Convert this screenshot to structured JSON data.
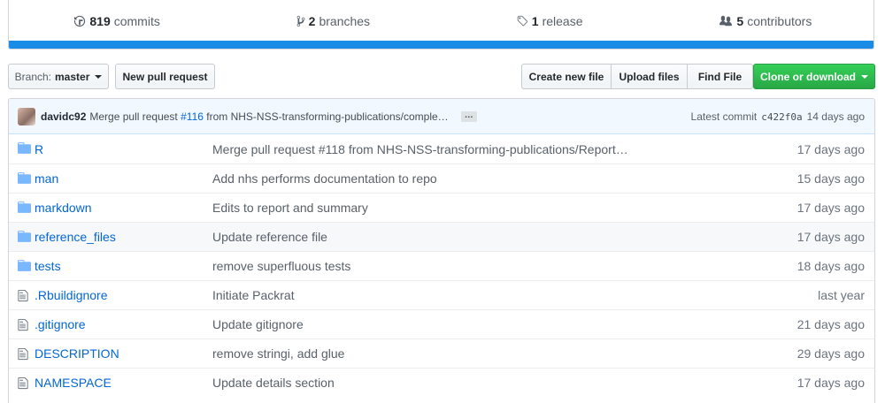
{
  "summary": {
    "commits": {
      "count": "819",
      "label": "commits",
      "icon": "history-icon"
    },
    "branches": {
      "count": "2",
      "label": "branches",
      "icon": "branch-icon"
    },
    "releases": {
      "count": "1",
      "label": "release",
      "icon": "tag-icon"
    },
    "contributors": {
      "count": "5",
      "label": "contributors",
      "icon": "people-icon"
    },
    "language_bar_color": "#198ce7"
  },
  "toolbar": {
    "branch_prefix": "Branch:",
    "branch_name": "master",
    "new_pr": "New pull request",
    "create_file": "Create new file",
    "upload_files": "Upload files",
    "find_file": "Find File",
    "clone": "Clone or download"
  },
  "commit": {
    "author": "davidc92",
    "message_prefix": "Merge pull request",
    "pr": "#116",
    "message_rest": "from NHS-NSS-transforming-publications/comple…",
    "ellipsis": "…",
    "latest_label": "Latest commit",
    "sha": "c422f0a",
    "age": "14 days ago"
  },
  "files": [
    {
      "type": "dir",
      "name": "R",
      "message": "Merge pull request #118 from NHS-NSS-transforming-publications/Report…",
      "age": "17 days ago"
    },
    {
      "type": "dir",
      "name": "man",
      "message": "Add nhs performs documentation to repo",
      "age": "15 days ago"
    },
    {
      "type": "dir",
      "name": "markdown",
      "message": "Edits to report and summary",
      "age": "17 days ago"
    },
    {
      "type": "dir",
      "name": "reference_files",
      "message": "Update reference file",
      "age": "17 days ago"
    },
    {
      "type": "dir",
      "name": "tests",
      "message": "remove superfluous tests",
      "age": "18 days ago"
    },
    {
      "type": "file",
      "name": ".Rbuildignore",
      "message": "Initiate Packrat",
      "age": "last year"
    },
    {
      "type": "file",
      "name": ".gitignore",
      "message": "Update gitignore",
      "age": "21 days ago"
    },
    {
      "type": "file",
      "name": "DESCRIPTION",
      "message": "remove stringi, add glue",
      "age": "29 days ago"
    },
    {
      "type": "file",
      "name": "NAMESPACE",
      "message": "Update details section",
      "age": "17 days ago"
    }
  ]
}
